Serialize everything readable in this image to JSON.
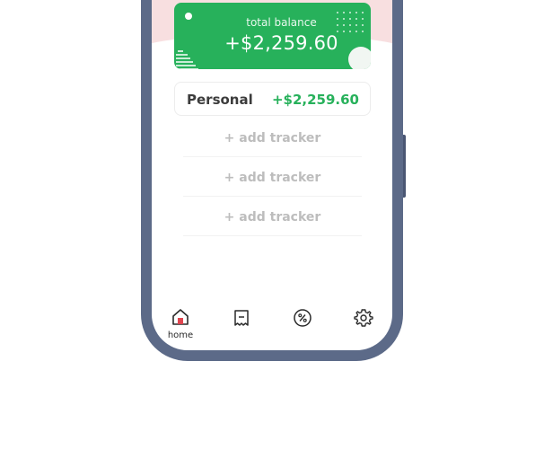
{
  "balance_card": {
    "label": "total balance",
    "amount": "+$2,259.60"
  },
  "trackers": [
    {
      "name": "Personal",
      "amount": "+$2,259.60"
    }
  ],
  "add_tracker_label": "+ add tracker",
  "add_tracker_rows": [
    "+ add tracker",
    "+ add tracker",
    "+ add tracker"
  ],
  "bottom_nav": [
    {
      "label": "home",
      "icon": "home-icon",
      "active": true
    },
    {
      "label": "",
      "icon": "receipt-icon",
      "active": false
    },
    {
      "label": "",
      "icon": "percent-icon",
      "active": false
    },
    {
      "label": "",
      "icon": "gear-icon",
      "active": false
    }
  ],
  "colors": {
    "accent_green": "#27b15b",
    "phone_frame": "#5c6a88",
    "header_pink": "#f8dfe0",
    "home_icon_red": "#e0454f"
  }
}
